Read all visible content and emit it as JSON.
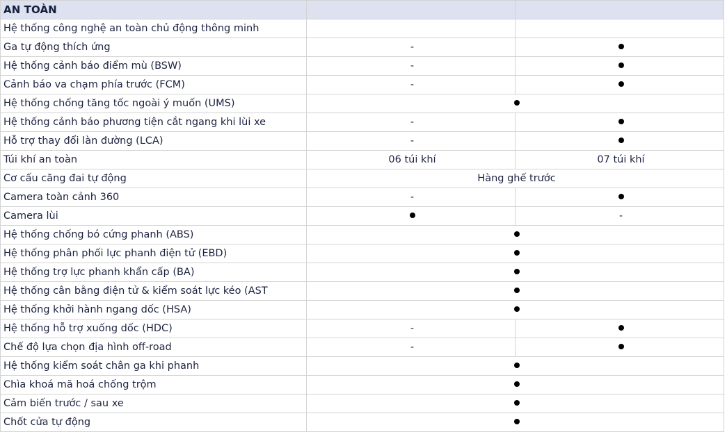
{
  "section": {
    "title": "AN TOÀN"
  },
  "columns": {
    "feature_header": "",
    "variant_a_header": "",
    "variant_b_header": ""
  },
  "symbols": {
    "dot": "●",
    "dash": "-"
  },
  "colors": {
    "header_band": "#dde1f0",
    "text": "#1c2340",
    "grid_line": "#d3d3d3",
    "dot": "#000000",
    "page_background": "#ffffff"
  },
  "rows": [
    {
      "feature": "Hệ thống công nghệ an toàn chủ động thông minh",
      "merged": false,
      "a": {
        "kind": "empty",
        "text": ""
      },
      "b": {
        "kind": "empty",
        "text": ""
      }
    },
    {
      "feature": "Ga tự động thích ứng",
      "merged": false,
      "a": {
        "kind": "dash",
        "text": "-"
      },
      "b": {
        "kind": "dot",
        "text": "●"
      }
    },
    {
      "feature": "Hệ thống cảnh báo điểm mù (BSW)",
      "merged": false,
      "a": {
        "kind": "dash",
        "text": "-"
      },
      "b": {
        "kind": "dot",
        "text": "●"
      }
    },
    {
      "feature": "Cảnh báo va chạm phía trước (FCM)",
      "merged": false,
      "a": {
        "kind": "dash",
        "text": "-"
      },
      "b": {
        "kind": "dot",
        "text": "●"
      }
    },
    {
      "feature": "Hệ thống chống tăng tốc ngoài ý muốn (UMS)",
      "merged": true,
      "merged_value": {
        "kind": "dot",
        "text": "●"
      }
    },
    {
      "feature": "Hệ thống cảnh báo phương tiện cắt ngang khi lùi xe",
      "merged": false,
      "a": {
        "kind": "dash",
        "text": "-"
      },
      "b": {
        "kind": "dot",
        "text": "●"
      }
    },
    {
      "feature": "Hỗ trợ thay đổi làn đường (LCA)",
      "merged": false,
      "a": {
        "kind": "dash",
        "text": "-"
      },
      "b": {
        "kind": "dot",
        "text": "●"
      }
    },
    {
      "feature": "Túi khí an toàn",
      "merged": false,
      "a": {
        "kind": "text",
        "text": "06 túi khí"
      },
      "b": {
        "kind": "text",
        "text": "07 túi khí"
      }
    },
    {
      "feature": "Cơ cấu căng đai tự động",
      "merged": true,
      "merged_value": {
        "kind": "text",
        "text": "Hàng ghế trước"
      }
    },
    {
      "feature": "Camera toàn cảnh 360",
      "merged": false,
      "a": {
        "kind": "dash",
        "text": "-"
      },
      "b": {
        "kind": "dot",
        "text": "●"
      }
    },
    {
      "feature": "Camera lùi",
      "merged": false,
      "a": {
        "kind": "dot",
        "text": "●"
      },
      "b": {
        "kind": "dash",
        "text": "-"
      }
    },
    {
      "feature": "Hệ thống chống bó cứng phanh (ABS)",
      "merged": true,
      "merged_value": {
        "kind": "dot",
        "text": "●"
      }
    },
    {
      "feature": "Hệ thống phân phối lực phanh điện tử (EBD)",
      "merged": true,
      "merged_value": {
        "kind": "dot",
        "text": "●"
      }
    },
    {
      "feature": "Hệ thống trợ lực phanh khẩn cấp (BA)",
      "merged": true,
      "merged_value": {
        "kind": "dot",
        "text": "●"
      }
    },
    {
      "feature": "Hệ thống cân bằng điện tử & kiểm soát lực kéo (AST",
      "merged": true,
      "merged_value": {
        "kind": "dot",
        "text": "●"
      }
    },
    {
      "feature": "Hệ thống khởi hành ngang dốc (HSA)",
      "merged": true,
      "merged_value": {
        "kind": "dot",
        "text": "●"
      }
    },
    {
      "feature": "Hệ thống hỗ trợ xuống dốc (HDC)",
      "merged": false,
      "a": {
        "kind": "dash",
        "text": "-"
      },
      "b": {
        "kind": "dot",
        "text": "●"
      }
    },
    {
      "feature": "Chế độ lựa chọn địa hình off-road",
      "merged": false,
      "a": {
        "kind": "dash",
        "text": "-"
      },
      "b": {
        "kind": "dot",
        "text": "●"
      }
    },
    {
      "feature": "Hệ thống kiểm soát chân ga khi phanh",
      "merged": true,
      "merged_value": {
        "kind": "dot",
        "text": "●"
      }
    },
    {
      "feature": "Chìa khoá mã hoá chống trộm",
      "merged": true,
      "merged_value": {
        "kind": "dot",
        "text": "●"
      }
    },
    {
      "feature": "Cảm biến trước / sau xe",
      "merged": true,
      "merged_value": {
        "kind": "dot",
        "text": "●"
      }
    },
    {
      "feature": "Chốt cửa tự động",
      "merged": true,
      "merged_value": {
        "kind": "dot",
        "text": "●"
      }
    }
  ]
}
